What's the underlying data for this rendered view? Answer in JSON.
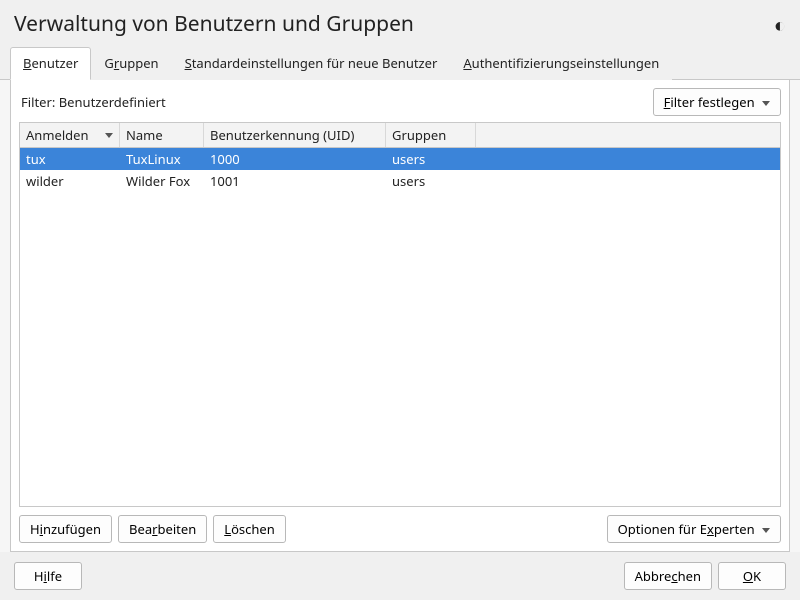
{
  "title": "Verwaltung von Benutzern und Gruppen",
  "tabs": {
    "benutzer": {
      "pre": "",
      "mn": "B",
      "post": "enutzer"
    },
    "gruppen": {
      "pre": "G",
      "mn": "r",
      "post": "uppen"
    },
    "defaults": {
      "pre": "",
      "mn": "S",
      "post": "tandardeinstellungen für neue Benutzer"
    },
    "auth": {
      "pre": "",
      "mn": "A",
      "post": "uthentifizierungseinstellungen"
    }
  },
  "filter": {
    "label": "Filter: Benutzerdefiniert",
    "set_button": {
      "pre": "",
      "mn": "F",
      "post": "ilter festlegen"
    }
  },
  "table": {
    "headers": {
      "login": "Anmelden",
      "name": "Name",
      "uid": "Benutzerkennung (UID)",
      "groups": "Gruppen"
    },
    "rows": [
      {
        "login": "tux",
        "name": "TuxLinux",
        "uid": "1000",
        "groups": "users",
        "selected": true
      },
      {
        "login": "wilder",
        "name": "Wilder Fox",
        "uid": "1001",
        "groups": "users",
        "selected": false
      }
    ]
  },
  "actions": {
    "add": {
      "pre": "H",
      "mn": "i",
      "post": "nzufügen"
    },
    "edit": {
      "pre": "Bea",
      "mn": "r",
      "post": "beiten"
    },
    "delete": {
      "pre": "",
      "mn": "L",
      "post": "öschen"
    },
    "expert": {
      "pre": "Optionen für E",
      "mn": "x",
      "post": "perten"
    }
  },
  "footer": {
    "help": {
      "pre": "H",
      "mn": "i",
      "post": "lfe"
    },
    "cancel": {
      "pre": "Abbre",
      "mn": "c",
      "post": "hen"
    },
    "ok": {
      "pre": "",
      "mn": "O",
      "post": "K"
    }
  }
}
